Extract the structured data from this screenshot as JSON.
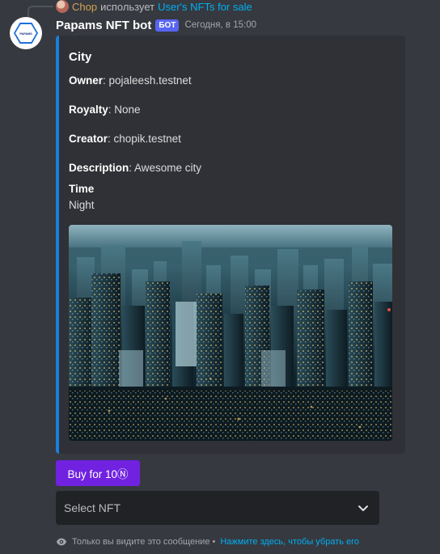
{
  "reply": {
    "user": "Chop",
    "action": "использует",
    "command": "User's NFTs for sale"
  },
  "message": {
    "username": "Papams NFT bot",
    "bot_tag": "БОТ",
    "timestamp": "Сегодня, в 15:00",
    "avatar_text": "PAPAMS"
  },
  "embed": {
    "accent_color": "#1a7fdc",
    "title": "City",
    "fields": [
      {
        "name": "Owner",
        "value": "pojaleesh.testnet"
      },
      {
        "name": "Royalty",
        "value": "None"
      },
      {
        "name": "Creator",
        "value": "chopik.testnet"
      },
      {
        "name": "Description",
        "value": "Awesome city"
      }
    ],
    "time_label": "Time",
    "time_value": "Night"
  },
  "components": {
    "buy_button_label": "Buy for 10Ⓝ",
    "buy_button_color": "#7022e0",
    "select_placeholder": "Select NFT"
  },
  "footer": {
    "ephemeral_text": "Только вы видите это сообщение •",
    "dismiss_link": "Нажмите здесь, чтобы убрать его"
  }
}
